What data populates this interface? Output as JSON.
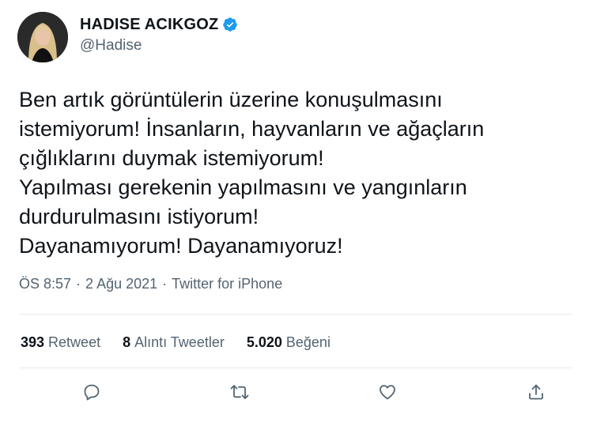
{
  "user": {
    "display_name": "HADISE ACIKGOZ",
    "handle": "@Hadise",
    "verified": true
  },
  "tweet": {
    "lines": [
      "Ben artık görüntülerin üzerine konuşulmasını",
      "istemiyorum! İnsanların, hayvanların ve ağaçların",
      "çığlıklarını duymak istemiyorum!",
      "Yapılması gerekenin yapılmasını ve yangınların",
      "durdurulmasını istiyorum!",
      "Dayanamıyorum! Dayanamıyoruz!"
    ],
    "time": "ÖS 8:57",
    "date": "2 Ağu 2021",
    "source": "Twitter for iPhone",
    "separator": "·"
  },
  "stats": {
    "retweets": {
      "count": "393",
      "label": "Retweet"
    },
    "quotes": {
      "count": "8",
      "label": "Alıntı Tweetler"
    },
    "likes": {
      "count": "5.020",
      "label": "Beğeni"
    }
  },
  "actions": [
    "reply-icon",
    "retweet-icon",
    "like-icon",
    "share-icon"
  ],
  "colors": {
    "text": "#0f1419",
    "muted": "#536471",
    "verified": "#1d9bf0",
    "divider": "#e6ecf0"
  }
}
